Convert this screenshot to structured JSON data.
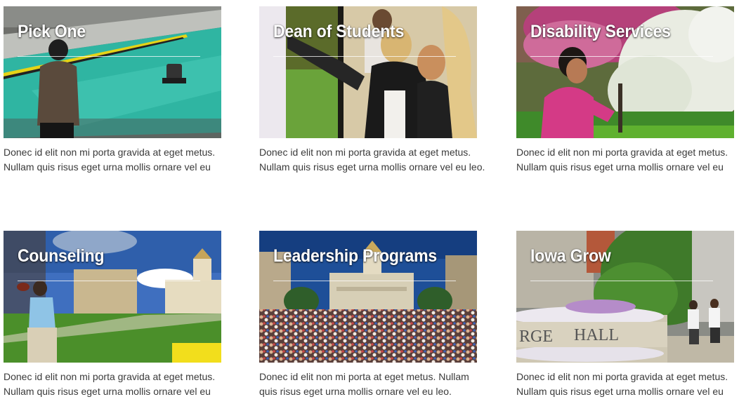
{
  "cards": [
    {
      "title": "Pick One",
      "desc_line1": "Donec id elit non mi porta gravida at eget metus.",
      "desc_line2": "Nullam quis risus eget urna mollis ornare vel eu"
    },
    {
      "title": "Dean of Students",
      "desc_line1": "Donec id elit non mi porta gravida at eget metus.",
      "desc_line2": "Nullam quis risus eget urna mollis ornare vel eu leo."
    },
    {
      "title": "Disability Services",
      "desc_line1": "Donec id elit non mi porta gravida at eget metus.",
      "desc_line2": "Nullam quis risus eget urna mollis ornare vel eu"
    },
    {
      "title": "Counseling",
      "desc_line1": "Donec id elit non mi porta gravida at eget metus.",
      "desc_line2": "Nullam quis risus eget urna mollis ornare vel eu"
    },
    {
      "title": "Leadership Programs",
      "desc_line1": "Donec id elit non mi porta at eget metus. Nullam",
      "desc_line2": "quis risus eget urna mollis ornare vel eu leo."
    },
    {
      "title": "Iowa Grow",
      "desc_line1": "Donec id elit non mi porta gravida at eget metus.",
      "desc_line2": "Nullam quis risus eget urna mollis ornare vel eu"
    }
  ]
}
